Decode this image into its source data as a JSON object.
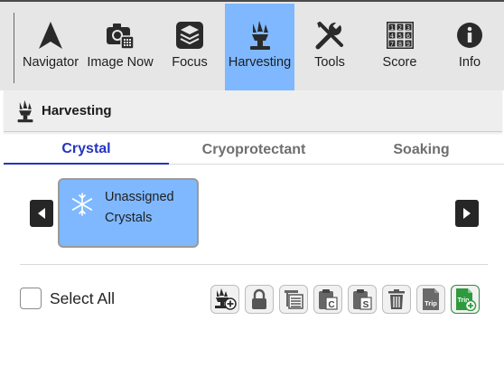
{
  "toolbar": {
    "items": [
      {
        "label": "Navigator",
        "icon": "navigator-arrow-icon"
      },
      {
        "label": "Image Now",
        "icon": "camera-icon"
      },
      {
        "label": "Focus",
        "icon": "focus-layers-icon"
      },
      {
        "label": "Harvesting",
        "icon": "harvesting-tool-icon",
        "active": true
      },
      {
        "label": "Tools",
        "icon": "wrench-screwdriver-icon"
      },
      {
        "label": "Score",
        "icon": "score-grid-icon"
      },
      {
        "label": "Info",
        "icon": "info-icon"
      }
    ],
    "active_color": "#7fb8ff"
  },
  "section": {
    "title": "Harvesting",
    "icon": "harvesting-tool-icon"
  },
  "tabs": [
    {
      "label": "Crystal",
      "active": true
    },
    {
      "label": "Cryoprotectant",
      "active": false
    },
    {
      "label": "Soaking",
      "active": false
    }
  ],
  "accent_color": "#2434c4",
  "card": {
    "line1": "Unassigned",
    "line2": "Crystals",
    "icon": "snowflake-icon",
    "selected": true
  },
  "select_all": {
    "label": "Select All",
    "checked": false
  },
  "actions": [
    {
      "name": "add-harvest-button",
      "icon": "harvest-add-icon"
    },
    {
      "name": "lock-button",
      "icon": "lock-icon"
    },
    {
      "name": "list-button",
      "icon": "list-icon"
    },
    {
      "name": "clipboard-c-button",
      "icon": "clipboard-c-icon",
      "text": "C"
    },
    {
      "name": "clipboard-s-button",
      "icon": "clipboard-s-icon",
      "text": "S"
    },
    {
      "name": "delete-button",
      "icon": "trash-icon"
    },
    {
      "name": "trip-button",
      "icon": "trip-icon",
      "text": "Trip"
    },
    {
      "name": "add-trip-button",
      "icon": "trip-add-icon",
      "text": "Trip"
    }
  ]
}
